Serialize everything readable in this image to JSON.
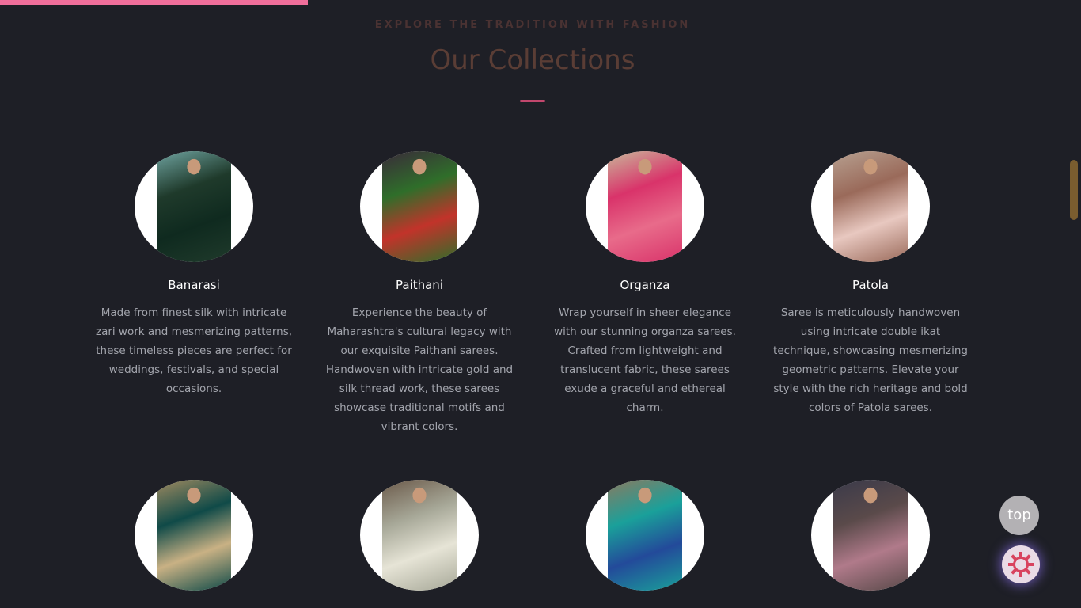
{
  "header": {
    "eyebrow": "EXPLORE THE TRADITION WITH FASHION",
    "title": "Our Collections"
  },
  "scroll_progress": 0.285,
  "collections_row1": [
    {
      "name": "Banarasi",
      "description": "Made from finest silk with intricate zari work and mesmerizing patterns, these timeless pieces are perfect for weddings, festivals, and special occasions.",
      "image_colors": [
        "#1f3a2b",
        "#0f2a1f",
        "#6fa3a0"
      ]
    },
    {
      "name": "Paithani",
      "description": "Experience the beauty of Maharashtra's cultural legacy with our exquisite Paithani sarees. Handwoven with intricate gold and silk thread work, these sarees showcase traditional motifs and vibrant colors.",
      "image_colors": [
        "#2f6e2a",
        "#c2332a",
        "#3a2a3a"
      ]
    },
    {
      "name": "Organza",
      "description": "Wrap yourself in sheer elegance with our stunning organza sarees. Crafted from lightweight and translucent fabric, these sarees exude a graceful and ethereal charm.",
      "image_colors": [
        "#d9336a",
        "#e86b8a",
        "#c9b79a"
      ]
    },
    {
      "name": "Patola",
      "description": "Saree is meticulously handwoven using intricate double ikat technique, showcasing mesmerizing geometric patterns. Elevate your style with the rich heritage and bold colors of Patola sarees.",
      "image_colors": [
        "#9a6a5a",
        "#e8c8c0",
        "#b7a090"
      ]
    }
  ],
  "collections_row2": [
    {
      "image_colors": [
        "#0f4a48",
        "#c9b184",
        "#a08a60"
      ]
    },
    {
      "image_colors": [
        "#a7a898",
        "#e6e4d6",
        "#6b5a4a"
      ]
    },
    {
      "image_colors": [
        "#1aa09a",
        "#234a9a",
        "#8a7a60"
      ]
    },
    {
      "image_colors": [
        "#5a4a4a",
        "#b07a8a",
        "#3a3a4a"
      ]
    }
  ],
  "buttons": {
    "top_label": "top",
    "theme_icon": "sun-gear-icon"
  },
  "colors": {
    "background": "#1e1f26",
    "accent_pink": "#f06f9b",
    "divider": "#c2476d",
    "title": "#5a3d35"
  }
}
